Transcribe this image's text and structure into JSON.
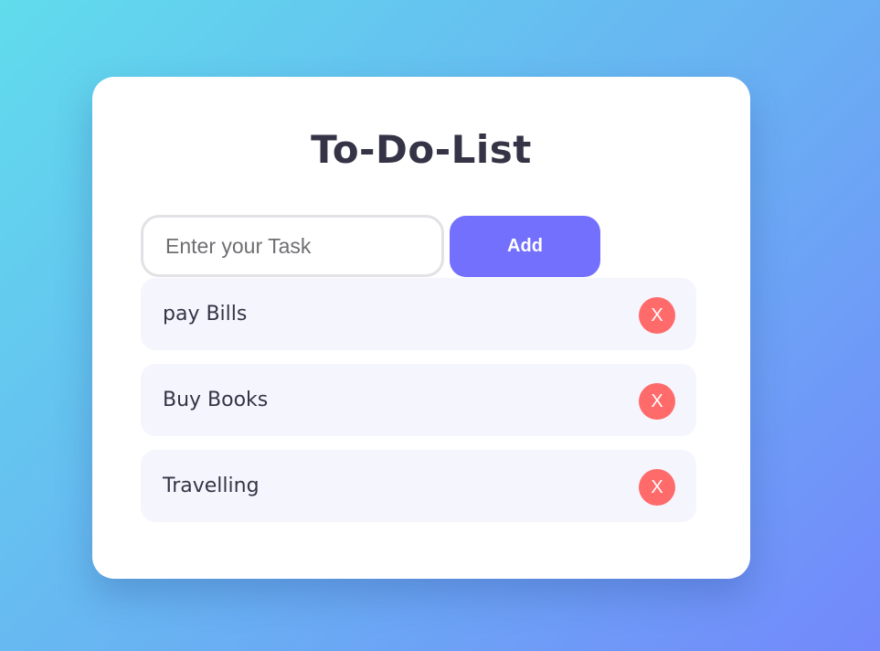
{
  "app": {
    "title": "To-Do-List"
  },
  "input": {
    "placeholder": "Enter your Task",
    "value": ""
  },
  "add_button": {
    "label": "Add"
  },
  "tasks": [
    {
      "text": "pay Bills",
      "delete_label": "X"
    },
    {
      "text": "Buy Books",
      "delete_label": "X"
    },
    {
      "text": "Travelling",
      "delete_label": "X"
    }
  ],
  "colors": {
    "accent": "#7270fd",
    "delete": "#ff6b6b",
    "title_text": "#343446",
    "item_background": "#f5f6fd"
  }
}
